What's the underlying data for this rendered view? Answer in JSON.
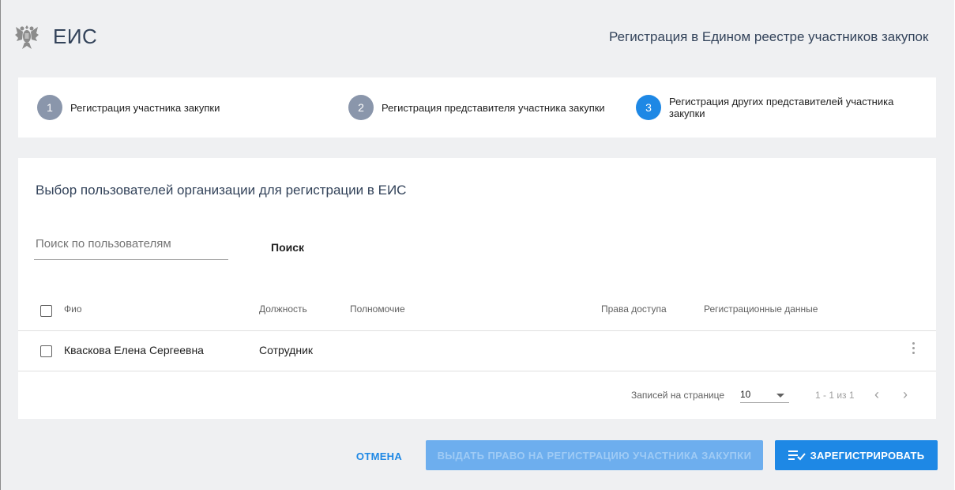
{
  "header": {
    "app_name": "ЕИС",
    "title": "Регистрация в Едином реестре участников закупок"
  },
  "stepper": {
    "steps": [
      {
        "num": "1",
        "label": "Регистрация участника закупки",
        "active": false
      },
      {
        "num": "2",
        "label": "Регистрация представителя участника закупки",
        "active": false
      },
      {
        "num": "3",
        "label": "Регистрация других представителей участника закупки",
        "active": true
      }
    ]
  },
  "main": {
    "title": "Выбор пользователей организации для регистрации в ЕИС",
    "search_placeholder": "Поиск по пользователям",
    "search_button": "Поиск",
    "table": {
      "columns": [
        "Фио",
        "Должность",
        "Полномочие",
        "Права доступа",
        "Регистрационные данные"
      ],
      "rows": [
        {
          "name": "Кваскова Елена Сергеевна",
          "position": "Сотрудник",
          "authority": "",
          "access": "",
          "reg_data": ""
        }
      ]
    },
    "pager": {
      "label": "Записей на странице",
      "page_size": "10",
      "range": "1 - 1 из 1"
    }
  },
  "footer": {
    "cancel": "ОТМЕНА",
    "grant": "ВЫДАТЬ ПРАВО НА РЕГИСТРАЦИЮ УЧАСТНИКА ЗАКУПКИ",
    "register": "ЗАРЕГИСТРИРОВАТЬ"
  },
  "colors": {
    "accent": "#1e88e5",
    "accent_disabled": "#6daeee",
    "step_inactive": "#8a96ab",
    "background": "#eff0f2"
  }
}
